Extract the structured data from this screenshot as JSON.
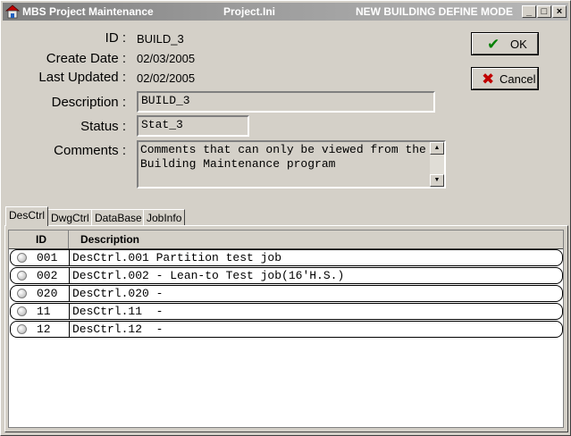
{
  "window": {
    "title": "MBS Project Maintenance",
    "file": "Project.Ini",
    "mode": "NEW BUILDING DEFINE MODE",
    "controls": {
      "minimize": "_",
      "maximize": "□",
      "close": "×"
    }
  },
  "form": {
    "id_label": "ID :",
    "id_value": "BUILD_3",
    "create_label": "Create Date :",
    "create_value": "02/03/2005",
    "updated_label": "Last Updated :",
    "updated_value": "02/02/2005",
    "description_label": "Description :",
    "description_value": "BUILD_3",
    "status_label": "Status :",
    "status_value": "Stat_3",
    "comments_label": "Comments :",
    "comments_value": "Comments that can only be viewed from the Building Maintenance program"
  },
  "buttons": {
    "ok_label": "OK",
    "cancel_label": "Cancel"
  },
  "tabs": [
    "DesCtrl",
    "DwgCtrl",
    "DataBase",
    "JobInfo"
  ],
  "grid": {
    "headers": {
      "id": "ID",
      "description": "Description"
    },
    "rows": [
      {
        "id": "001",
        "description": "DesCtrl.001 Partition test job"
      },
      {
        "id": "002",
        "description": "DesCtrl.002 - Lean-to Test job(16'H.S.)"
      },
      {
        "id": "020",
        "description": "DesCtrl.020 -"
      },
      {
        "id": "11",
        "description": "DesCtrl.11  -"
      },
      {
        "id": "12",
        "description": "DesCtrl.12  -"
      }
    ]
  },
  "colors": {
    "face": "#d4d0c8",
    "title_gradient_start": "#7f7f7f",
    "ok_check": "#008000",
    "cancel_x": "#c00000"
  }
}
